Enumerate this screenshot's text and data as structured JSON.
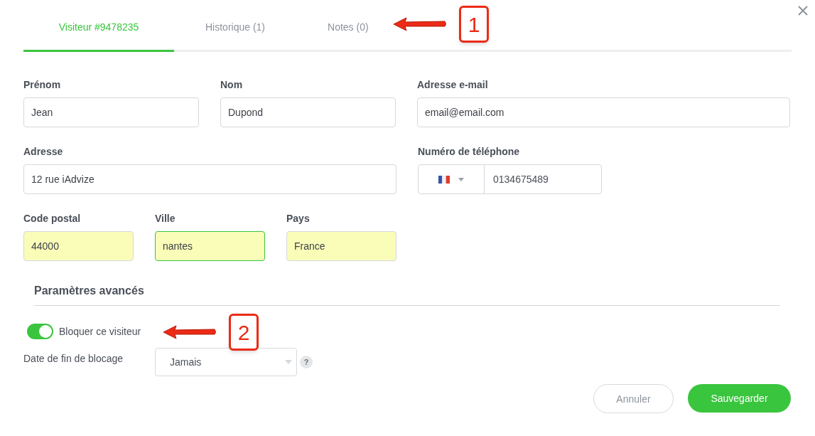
{
  "tabs": [
    {
      "label": "Visiteur #9478235",
      "selected": true
    },
    {
      "label": "Historique (1)",
      "selected": false
    },
    {
      "label": "Notes (0)",
      "selected": false
    }
  ],
  "form_rows": [
    [
      {
        "label": "Prénom",
        "value": "Jean",
        "kind": "text",
        "highlighted": false,
        "focused": false
      },
      {
        "label": "Nom",
        "value": "Dupond",
        "kind": "text",
        "highlighted": false,
        "focused": false
      },
      {
        "label": "Adresse e-mail",
        "value": "email@email.com",
        "kind": "text",
        "highlighted": false,
        "focused": false
      }
    ],
    [
      {
        "label": "Adresse",
        "value": "12 rue iAdvize",
        "kind": "text",
        "highlighted": false,
        "focused": false
      },
      {
        "label": "Numéro de téléphone",
        "value": "0134675489",
        "kind": "phone",
        "highlighted": false,
        "focused": false
      }
    ],
    [
      {
        "label": "Code postal",
        "value": "44000",
        "kind": "text",
        "highlighted": true,
        "focused": false
      },
      {
        "label": "Ville",
        "value": "nantes",
        "kind": "text",
        "highlighted": true,
        "focused": true
      },
      {
        "label": "Pays",
        "value": "France",
        "kind": "text",
        "highlighted": true,
        "focused": false
      }
    ]
  ],
  "advanced": {
    "title": "Paramètres avancés",
    "block_toggle": {
      "label": "Bloquer ce visiteur",
      "on": true
    },
    "end_date": {
      "label": "Date de fin de blocage",
      "value": "Jamais",
      "help": "?"
    }
  },
  "buttons": [
    {
      "label": "Annuler",
      "kind": "secondary"
    },
    {
      "label": "Sauvegarder",
      "kind": "primary"
    }
  ],
  "callouts": [
    {
      "number": "1"
    },
    {
      "number": "2"
    }
  ]
}
